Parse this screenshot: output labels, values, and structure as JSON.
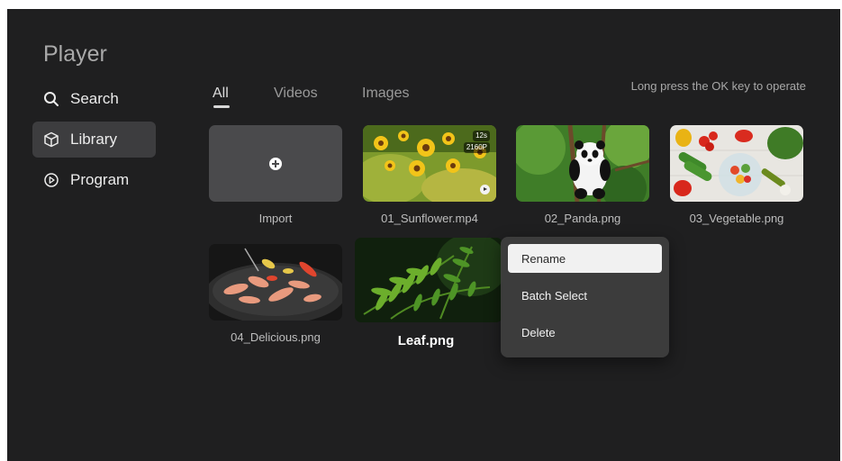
{
  "app": {
    "title": "Player"
  },
  "sidebar": {
    "items": [
      {
        "label": "Search",
        "icon": "search-icon",
        "active": false
      },
      {
        "label": "Library",
        "icon": "cube-icon",
        "active": true
      },
      {
        "label": "Program",
        "icon": "play-circle-icon",
        "active": false
      }
    ]
  },
  "tabs": [
    {
      "label": "All",
      "active": true
    },
    {
      "label": "Videos",
      "active": false
    },
    {
      "label": "Images",
      "active": false
    }
  ],
  "hint": "Long press the OK key to operate",
  "grid": {
    "items": [
      {
        "caption": "Import",
        "kind": "import"
      },
      {
        "caption": "01_Sunflower.mp4",
        "kind": "video",
        "duration": "12s",
        "resolution": "2160P"
      },
      {
        "caption": "02_Panda.png",
        "kind": "image"
      },
      {
        "caption": "03_Vegetable.png",
        "kind": "image"
      },
      {
        "caption": "04_Delicious.png",
        "kind": "image"
      },
      {
        "caption": "Leaf.png",
        "kind": "image",
        "focused": true
      }
    ]
  },
  "context_menu": {
    "items": [
      {
        "label": "Rename",
        "selected": true
      },
      {
        "label": "Batch Select",
        "selected": false
      },
      {
        "label": "Delete",
        "selected": false
      }
    ]
  },
  "colors": {
    "background": "#1f1f20",
    "sidebar_active": "#3d3d3f",
    "menu_background": "#3e3e3e",
    "menu_selected": "#f1f1f1"
  }
}
